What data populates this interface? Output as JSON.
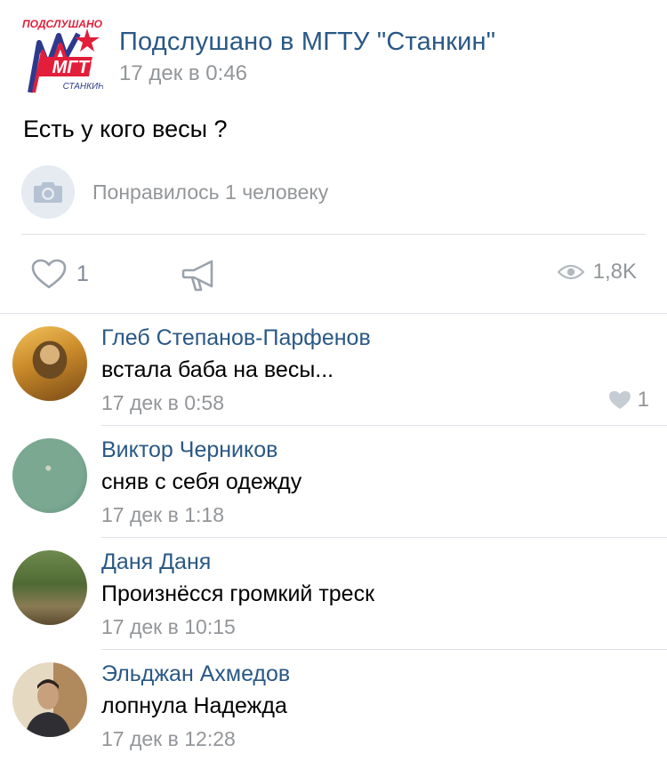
{
  "post": {
    "group_name": "Подслушано в МГТУ \"Станкин\"",
    "date": "17 дек в 0:46",
    "text": "Есть у кого весы ?",
    "liked_by": "Понравилось 1 человеку",
    "likes": "1",
    "views": "1,8K",
    "logo": {
      "top_text": "ПОДСЛУШАНО",
      "main_text": "МГТУ",
      "bottom_text": "СТАНКИН"
    }
  },
  "comments": [
    {
      "author": "Глеб Степанов-Парфенов",
      "text": "встала баба на весы...",
      "time": "17 дек в 0:58",
      "likes": "1"
    },
    {
      "author": "Виктор Черников",
      "text": "сняв с себя одежду",
      "time": "17 дек в 1:18"
    },
    {
      "author": "Даня Даня",
      "text": "Произнёсся громкий треск",
      "time": "17 дек в 10:15"
    },
    {
      "author": "Эльджан Ахмедов",
      "text": "лопнула Надежда",
      "time": "17 дек в 12:28"
    }
  ],
  "colors": {
    "link": "#2a5885",
    "secondary": "#939699",
    "icon": "#828a99",
    "divider": "#dfe2e7",
    "logo_red": "#e21e3a",
    "logo_blue": "#2d3a8c"
  },
  "icons": {
    "like": "heart-outline-icon",
    "share": "megaphone-icon",
    "views": "eye-icon",
    "liked_by": "camera-icon",
    "comment_like": "heart-filled-icon"
  }
}
